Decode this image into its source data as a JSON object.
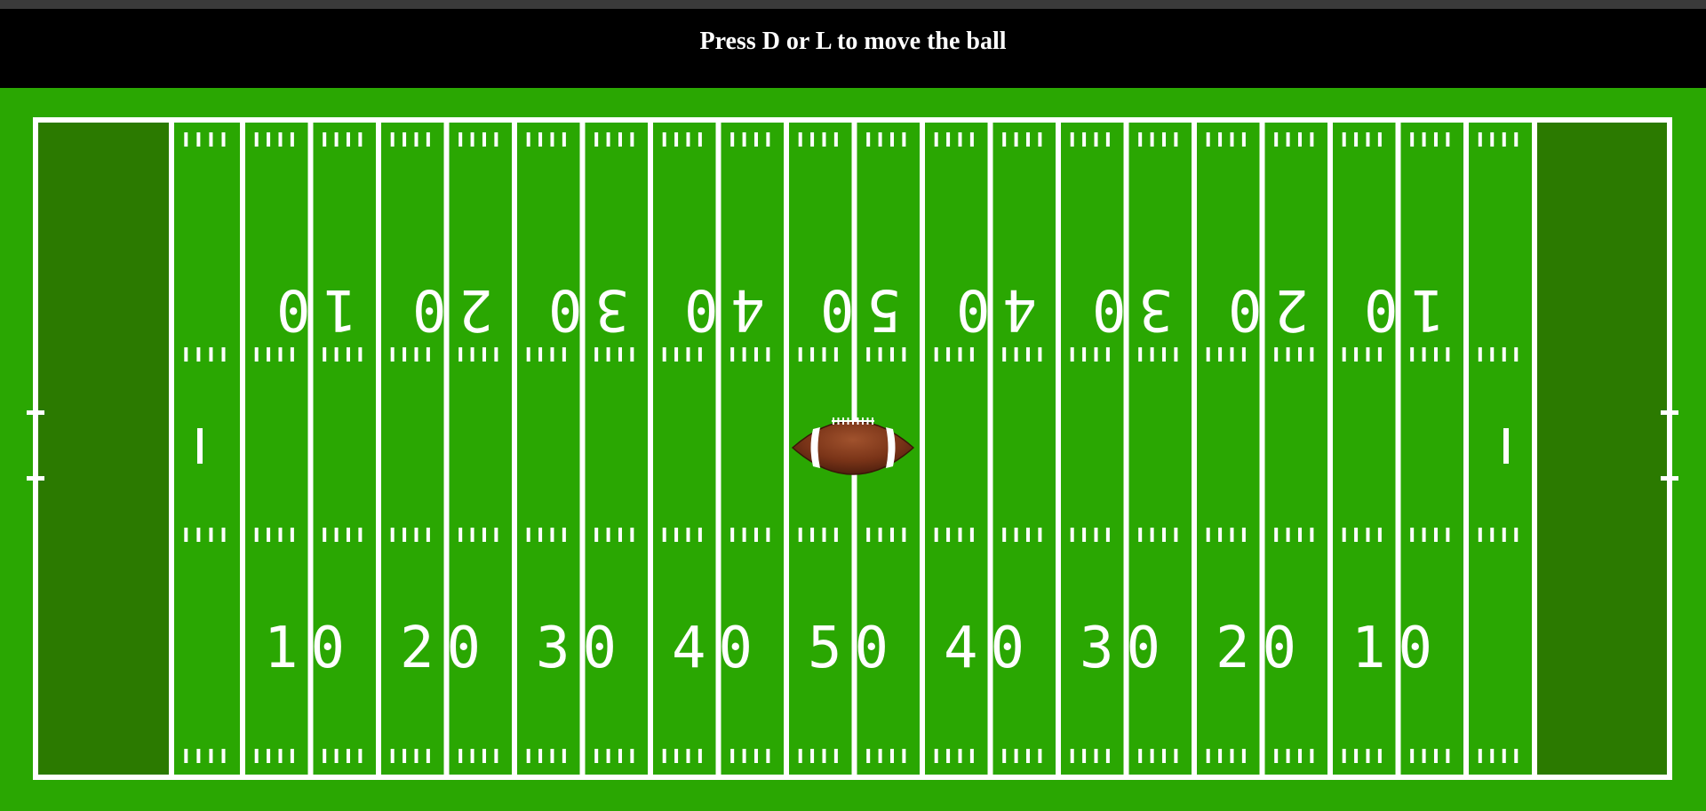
{
  "header": {
    "instruction": "Press D or L to move the ball"
  },
  "field": {
    "colors": {
      "grass": "#2aa702",
      "endzone": "#2b7a00",
      "lines": "#ffffff",
      "banner": "#000000"
    },
    "yard_numbers_bottom": [
      "10",
      "20",
      "30",
      "40",
      "50",
      "40",
      "30",
      "20",
      "10"
    ],
    "yard_numbers_top": [
      "10",
      "20",
      "30",
      "40",
      "50",
      "40",
      "30",
      "20",
      "10"
    ]
  },
  "ball": {
    "icon": "football-icon"
  }
}
